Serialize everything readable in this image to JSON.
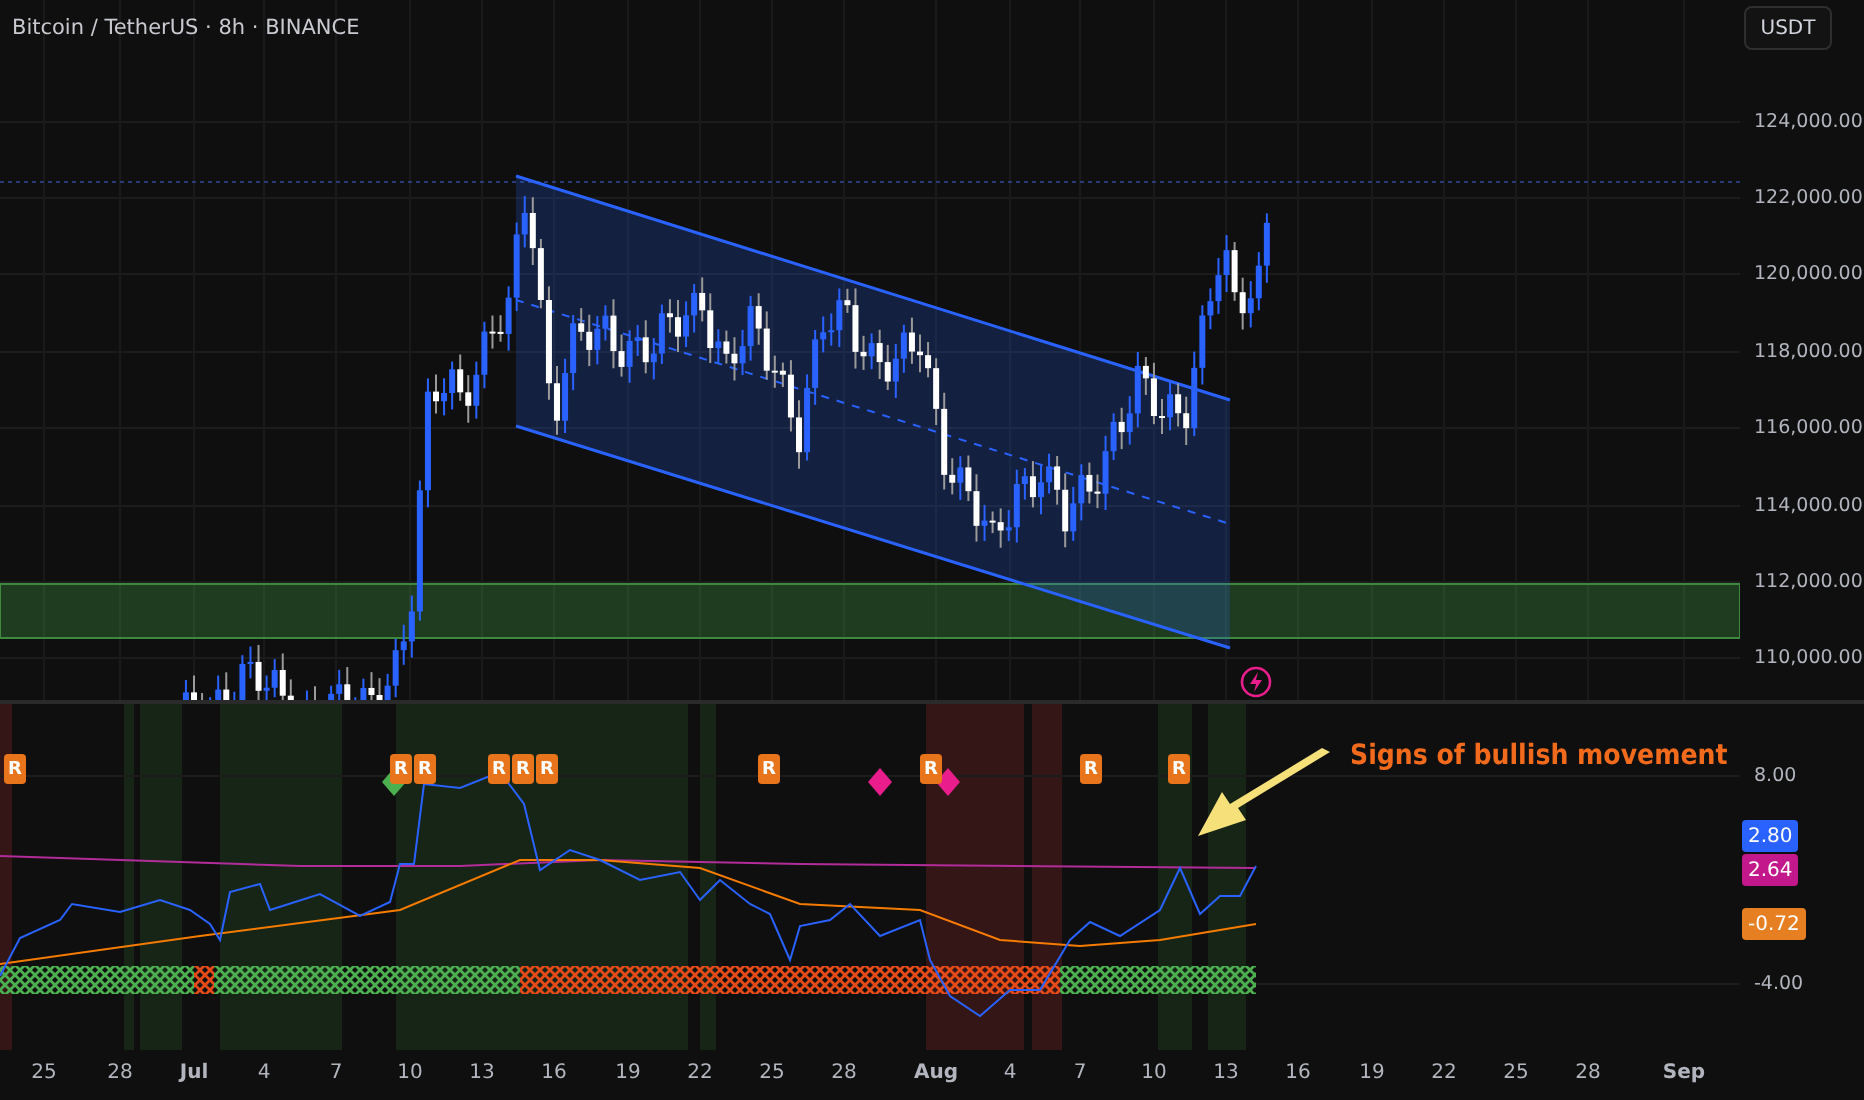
{
  "header": {
    "title": "Bitcoin / TetherUS · 8h · BINANCE"
  },
  "currency_button": {
    "label": "USDT"
  },
  "price_axis": {
    "labels": [
      "124,000.00",
      "122,000.00",
      "120,000.00",
      "118,000.00",
      "116,000.00",
      "114,000.00",
      "112,000.00",
      "110,000.00"
    ]
  },
  "indicator_axis": {
    "labels": [
      "8.00",
      "-4.00"
    ]
  },
  "value_badges": [
    {
      "label": "2.80",
      "color": "#2962ff"
    },
    {
      "label": "2.64",
      "color": "#c2188b"
    },
    {
      "label": "-0.72",
      "color": "#e67e22"
    }
  ],
  "signal_markers": [
    {
      "label": "R"
    },
    {
      "label": "R"
    },
    {
      "label": "R"
    },
    {
      "label": "R"
    },
    {
      "label": "R"
    },
    {
      "label": "R"
    },
    {
      "label": "R"
    },
    {
      "label": "R"
    },
    {
      "label": "R"
    },
    {
      "label": "R"
    }
  ],
  "diamond_markers": [
    {
      "color": "#4caf50"
    },
    {
      "color": "#e91e8c"
    },
    {
      "color": "#e91e8c"
    }
  ],
  "annotation": {
    "text": "Signs of bullish movement"
  },
  "date_axis": {
    "labels": [
      "25",
      "28",
      "Jul",
      "4",
      "7",
      "10",
      "13",
      "16",
      "19",
      "22",
      "25",
      "28",
      "Aug",
      "4",
      "7",
      "10",
      "13",
      "16",
      "19",
      "22",
      "25",
      "28",
      "Sep"
    ]
  }
}
